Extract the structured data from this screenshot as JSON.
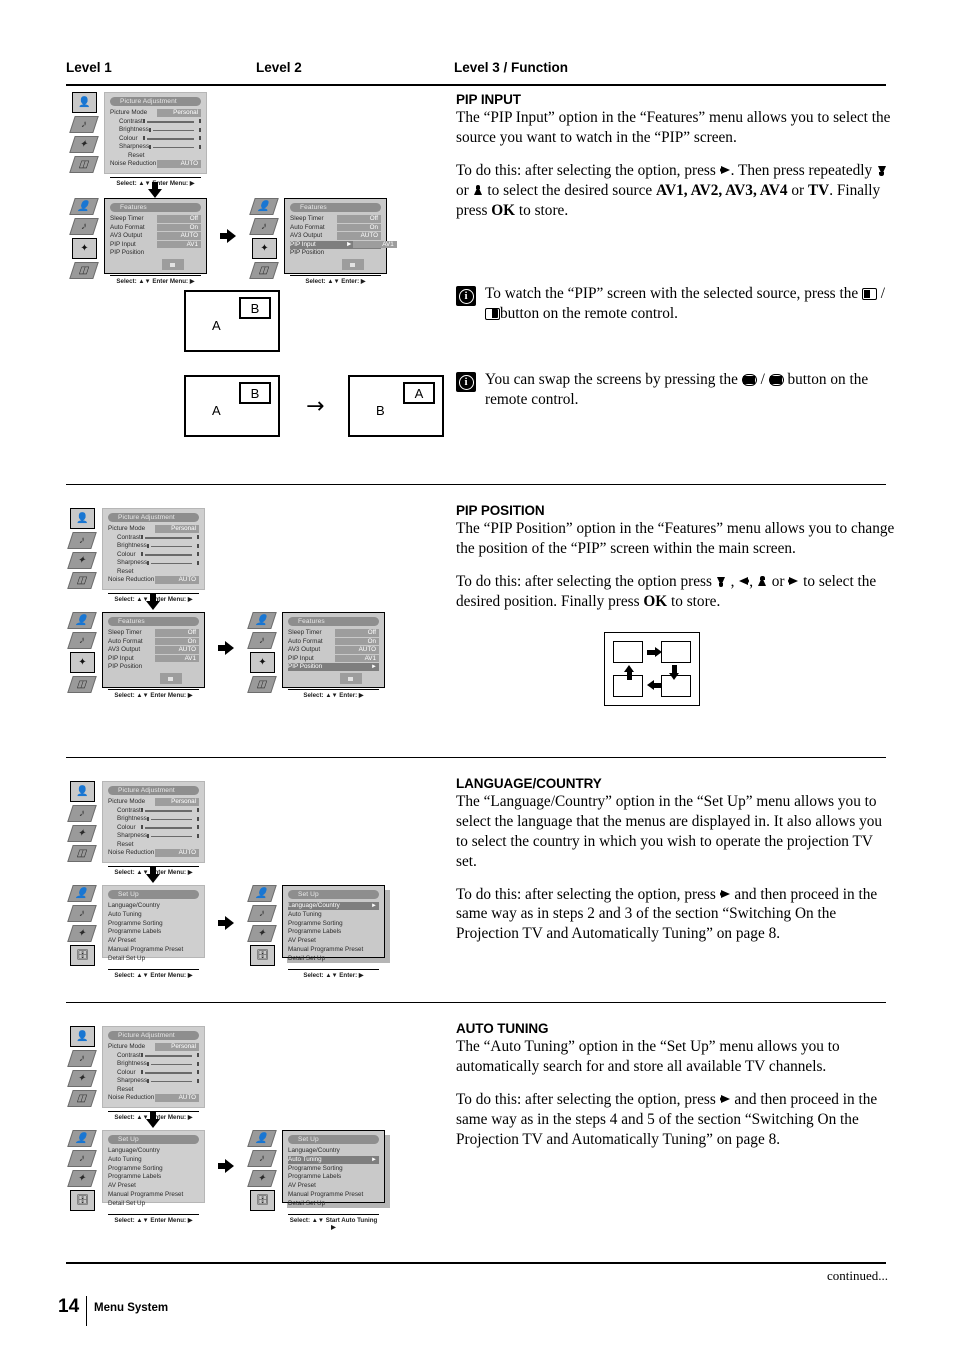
{
  "headers": {
    "level1": "Level 1",
    "level2": "Level 2",
    "level3": "Level 3 / Function"
  },
  "sections": [
    {
      "id": "pip-input",
      "title": "PIP INPUT",
      "p1": "The “PIP Input” option in the “Features”  menu allows you to select the source you want to watch in the “PIP” screen.",
      "p2_a": "To do this: after selecting the option, press ",
      "p2_b": ". Then press repeatedly ",
      "p2_c": " or ",
      "p2_d": " to select the desired source ",
      "p2_sources": "AV1, AV2, AV3, AV4",
      "p2_or": " or ",
      "p2_tv": "TV",
      "p2_e": ". Finally press ",
      "p2_ok": "OK",
      "p2_f": " to store."
    },
    {
      "id": "pip-position",
      "title": "PIP POSITION",
      "p1": "The “PIP Position” option in the “Features” menu allows you to change the position of the “PIP” screen within the main screen.",
      "p2_a": "To do this: after selecting the option press ",
      "p2_b": " , ",
      "p2_c": ", ",
      "p2_d": " or ",
      "p2_e": " to select the desired position. Finally press ",
      "p2_ok": "OK",
      "p2_f": " to store."
    },
    {
      "id": "language-country",
      "title": "LANGUAGE/COUNTRY",
      "p1": "The “Language/Country” option in the “Set Up” menu allows you to select the language that the menus are displayed in. It also allows you to select the country in which you wish to operate the projection TV set.",
      "p2_a": "To do this: after selecting the option, press ",
      "p2_b": " and then proceed in the same way as in steps 2 and 3 of the section “Switching On the Projection TV and Automatically Tuning” on page 8."
    },
    {
      "id": "auto-tuning",
      "title": "AUTO TUNING",
      "p1": "The “Auto Tuning” option in the “Set Up” menu allows you to automatically search for and store all available TV channels.",
      "p2_a": "To do this: after selecting the option, press ",
      "p2_b": " and then proceed in the same way as in the steps 4 and 5 of the section “Switching On the Projection TV and Automatically Tuning” on page 8."
    }
  ],
  "notes": [
    {
      "id": "note-pip-watch",
      "text_a": "To watch the “PIP” screen with the selected source, press the ",
      "text_b": " / ",
      "text_c": "button on the remote control."
    },
    {
      "id": "note-pip-swap",
      "text_a": "You can swap the screens by pressing the ",
      "text_b": " / ",
      "text_c": " button on the remote control."
    }
  ],
  "osd": {
    "picture_adjustment": {
      "title": "Picture Adjustment",
      "rows": [
        {
          "label": "Picture Mode",
          "value": "Personal",
          "type": "value"
        },
        {
          "label": "Contrast",
          "type": "slider"
        },
        {
          "label": "Brightness",
          "type": "slider"
        },
        {
          "label": "Colour",
          "type": "slider"
        },
        {
          "label": "Sharpness",
          "type": "slider"
        },
        {
          "label": "Reset",
          "type": "plain"
        },
        {
          "label": "Noise Reduction",
          "value": "AUTO",
          "type": "value"
        }
      ],
      "footer": "Select: ▲▼  Enter Menu: ▶"
    },
    "features": {
      "title": "Features",
      "rows": [
        {
          "label": "Sleep Timer",
          "value": "Off"
        },
        {
          "label": "Auto Format",
          "value": "On"
        },
        {
          "label": "AV3 Output",
          "value": "AUTO"
        },
        {
          "label": "PIP Input",
          "value": "AV1"
        },
        {
          "label": "PIP Position",
          "value": ""
        }
      ],
      "footer_enter_menu": "Select: ▲▼  Enter Menu: ▶",
      "footer_enter": "Select: ▲▼   Enter: ▶"
    },
    "setup": {
      "title": "Set Up",
      "rows": [
        {
          "label": "Language/Country"
        },
        {
          "label": "Auto Tuning"
        },
        {
          "label": "Programme Sorting"
        },
        {
          "label": "Programme Labels"
        },
        {
          "label": "AV Preset"
        },
        {
          "label": "Manual Programme Preset"
        },
        {
          "label": "Detail Set Up"
        }
      ],
      "footer_enter_menu": "Select: ▲▼  Enter Menu: ▶",
      "footer_enter": "Select: ▲▼   Enter: ▶",
      "footer_start_auto": "Select: ▲▼  Start Auto Tuning ▶"
    },
    "sidebar_icons": [
      "picture-icon",
      "sound-icon",
      "features-icon",
      "setup-icon"
    ]
  },
  "pip_diagram": {
    "main_label": "A",
    "sub_label": "B",
    "swapped_main_label": "B",
    "swapped_sub_label": "A",
    "swap_arrow": "→"
  },
  "footer": {
    "continued": "continued...",
    "page_number": "14",
    "page_label": "Menu System"
  }
}
